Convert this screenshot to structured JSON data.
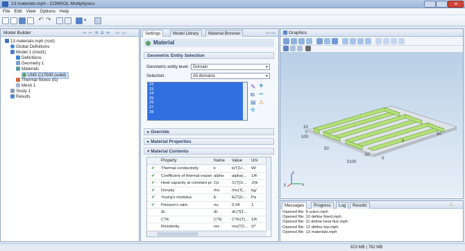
{
  "window": {
    "title": "13 materials.mph - COMSOL Multiphysics"
  },
  "menu": [
    "File",
    "Edit",
    "View",
    "Options",
    "Help"
  ],
  "model_builder": {
    "title": "Model Builder",
    "tree": [
      {
        "label": "13 materials.mph (root)"
      },
      {
        "label": "Global Definitions"
      },
      {
        "label": "Model 1 (mod1)"
      },
      {
        "label": "Definitions"
      },
      {
        "label": "Geometry 1"
      },
      {
        "label": "Materials"
      },
      {
        "label": "UNS C17500 (solid)"
      },
      {
        "label": "Thermal Stress (ts)"
      },
      {
        "label": "Mesh 1"
      },
      {
        "label": "Study 1"
      },
      {
        "label": "Results"
      }
    ]
  },
  "settings": {
    "tabs": [
      "Settings",
      "Model Library",
      "Material Browser"
    ],
    "header": "Material",
    "ges": {
      "title": "Geometric Entity Selection",
      "level_label": "Geometric entity level:",
      "level_value": "Domain",
      "selection_label": "Selection:",
      "selection_value": "All domains",
      "items": [
        "22",
        "23",
        "24",
        "25",
        "26",
        "27",
        "28"
      ]
    },
    "override": "Override",
    "material_properties": "Material Properties",
    "material_contents": {
      "title": "Material Contents",
      "columns": [
        "Property",
        "Name",
        "Value",
        "Uni"
      ],
      "rows": [
        {
          "checked": true,
          "property": "Thermal conductivity",
          "name": "k",
          "value": "k(T[1/...",
          "unit": "W/"
        },
        {
          "checked": true,
          "property": "Coefficient of thermal expan...",
          "name": "alpha",
          "value": "alpha(...",
          "unit": "1/K"
        },
        {
          "checked": true,
          "property": "Heat capacity at constant pr...",
          "name": "Cp",
          "value": "C(T[1/...",
          "unit": "J/(k"
        },
        {
          "checked": true,
          "property": "Density",
          "name": "rho",
          "value": "rho(T[...",
          "unit": "kg/"
        },
        {
          "checked": true,
          "property": "Young's modulus",
          "name": "E",
          "value": "E(T[1/...",
          "unit": "Pa"
        },
        {
          "checked": true,
          "property": "Poisson's ratio",
          "name": "nu",
          "value": "0.34",
          "unit": "1"
        },
        {
          "checked": false,
          "property": "dL",
          "name": "dL",
          "value": "dL(T[1...",
          "unit": ""
        },
        {
          "checked": false,
          "property": "CTE",
          "name": "CTE",
          "value": "CTE(T[...",
          "unit": "1/K"
        },
        {
          "checked": false,
          "property": "Resistivity",
          "name": "res",
          "value": "res(T[1...",
          "unit": "Ω*"
        }
      ]
    }
  },
  "graphics": {
    "title": "Graphics",
    "axis_labels": [
      "10",
      "0",
      "100",
      "50",
      "0",
      "-50",
      "50",
      "0",
      "0100"
    ],
    "triad": [
      "z",
      "y",
      "x"
    ]
  },
  "messages": {
    "tabs": [
      "Messages",
      "Progress",
      "Log",
      "Results"
    ],
    "lines": [
      "Opened file: 9 union.mph",
      "Opened file: 10 define fixed.mph",
      "Opened file: 11 define heat flux.mph",
      "Opened file: 12 define top.mph",
      "Opened file: 13 materials.mph"
    ]
  },
  "status": {
    "memory": "823 MB | 762 MB"
  },
  "colors": {
    "selection": "#2f6fe0",
    "beam": "#b4e07a",
    "accent": "#2f63b5"
  }
}
